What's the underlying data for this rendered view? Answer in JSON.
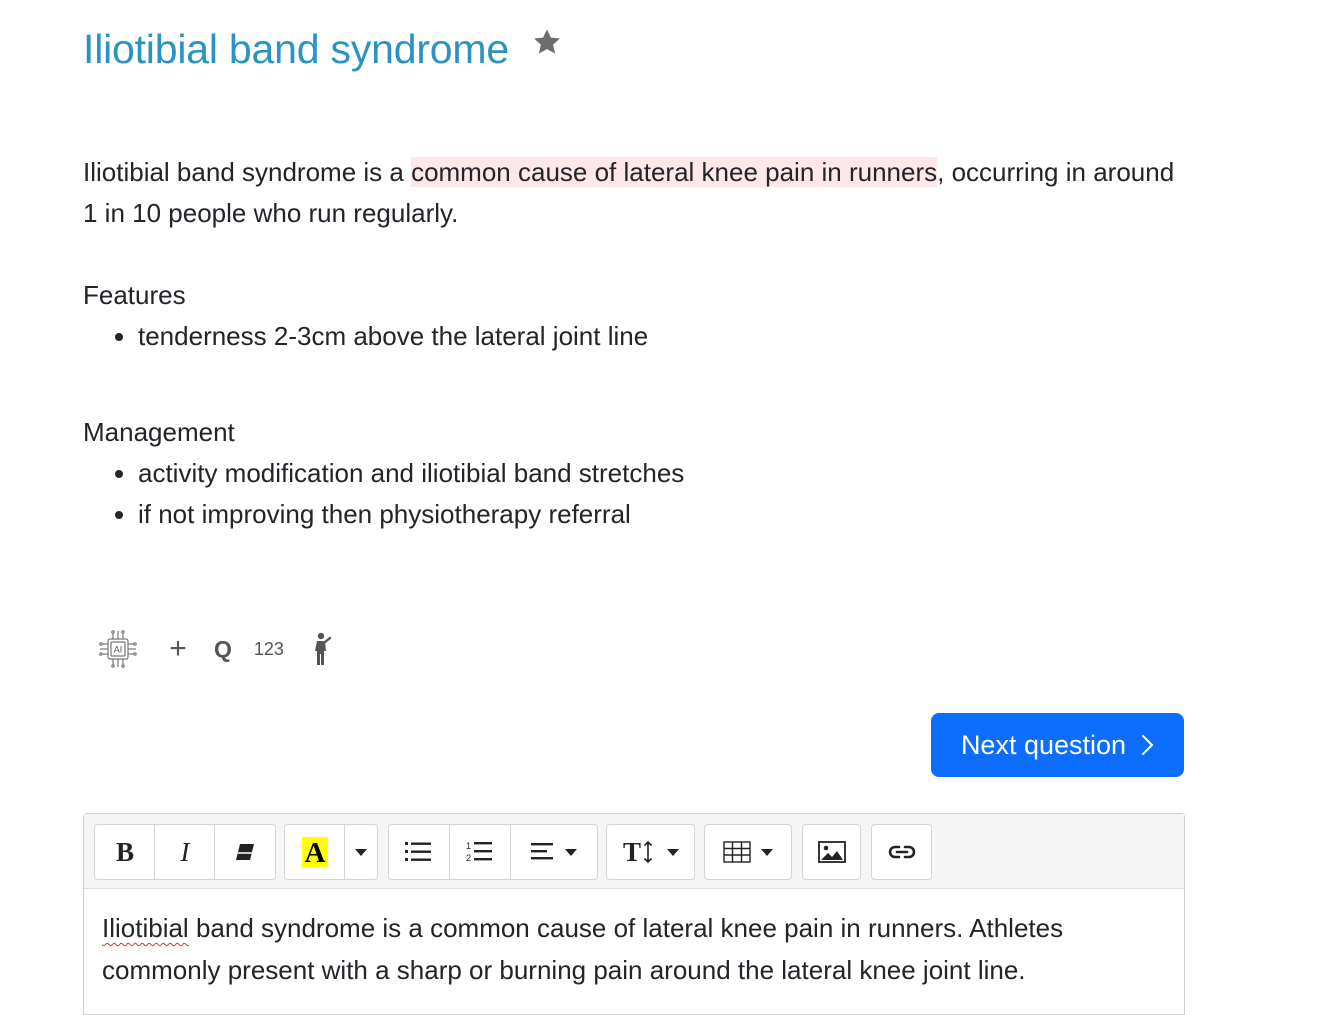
{
  "page": {
    "title": "Iliotibial band syndrome",
    "intro_before": "Iliotibial band syndrome is a ",
    "intro_highlight": "common cause of lateral knee pain in runners",
    "intro_after": ", occurring in around 1 in 10 people who run regularly.",
    "features_heading": "Features",
    "features": [
      "tenderness 2-3cm above the lateral joint line"
    ],
    "management_heading": "Management",
    "management": [
      "activity modification and iliotibial band stretches",
      "if not improving then physiotherapy referral"
    ]
  },
  "tools": {
    "ai_label": "AI",
    "plus_label": "+",
    "q_label": "Q",
    "number_label": "123"
  },
  "next_button": {
    "label": "Next question"
  },
  "editor": {
    "misspelled_word": "Iliotibial",
    "body_rest": " band syndrome is a common cause of lateral knee pain in runners. Athletes commonly present with a sharp or burning pain around the lateral knee joint line."
  },
  "colors": {
    "title": "#2a93c2",
    "highlight": "#fde7e9",
    "primary_button": "#0d6efd",
    "highlight_letter": "#ffff00"
  },
  "icons": [
    "star-icon",
    "ai-chip-icon",
    "plus-icon",
    "q-icon",
    "person-icon",
    "chevron-right-icon",
    "bold-icon",
    "italic-icon",
    "eraser-icon",
    "highlight-color-icon",
    "bullet-list-icon",
    "numbered-list-icon",
    "align-icon",
    "font-size-icon",
    "table-icon",
    "image-icon",
    "link-icon"
  ]
}
